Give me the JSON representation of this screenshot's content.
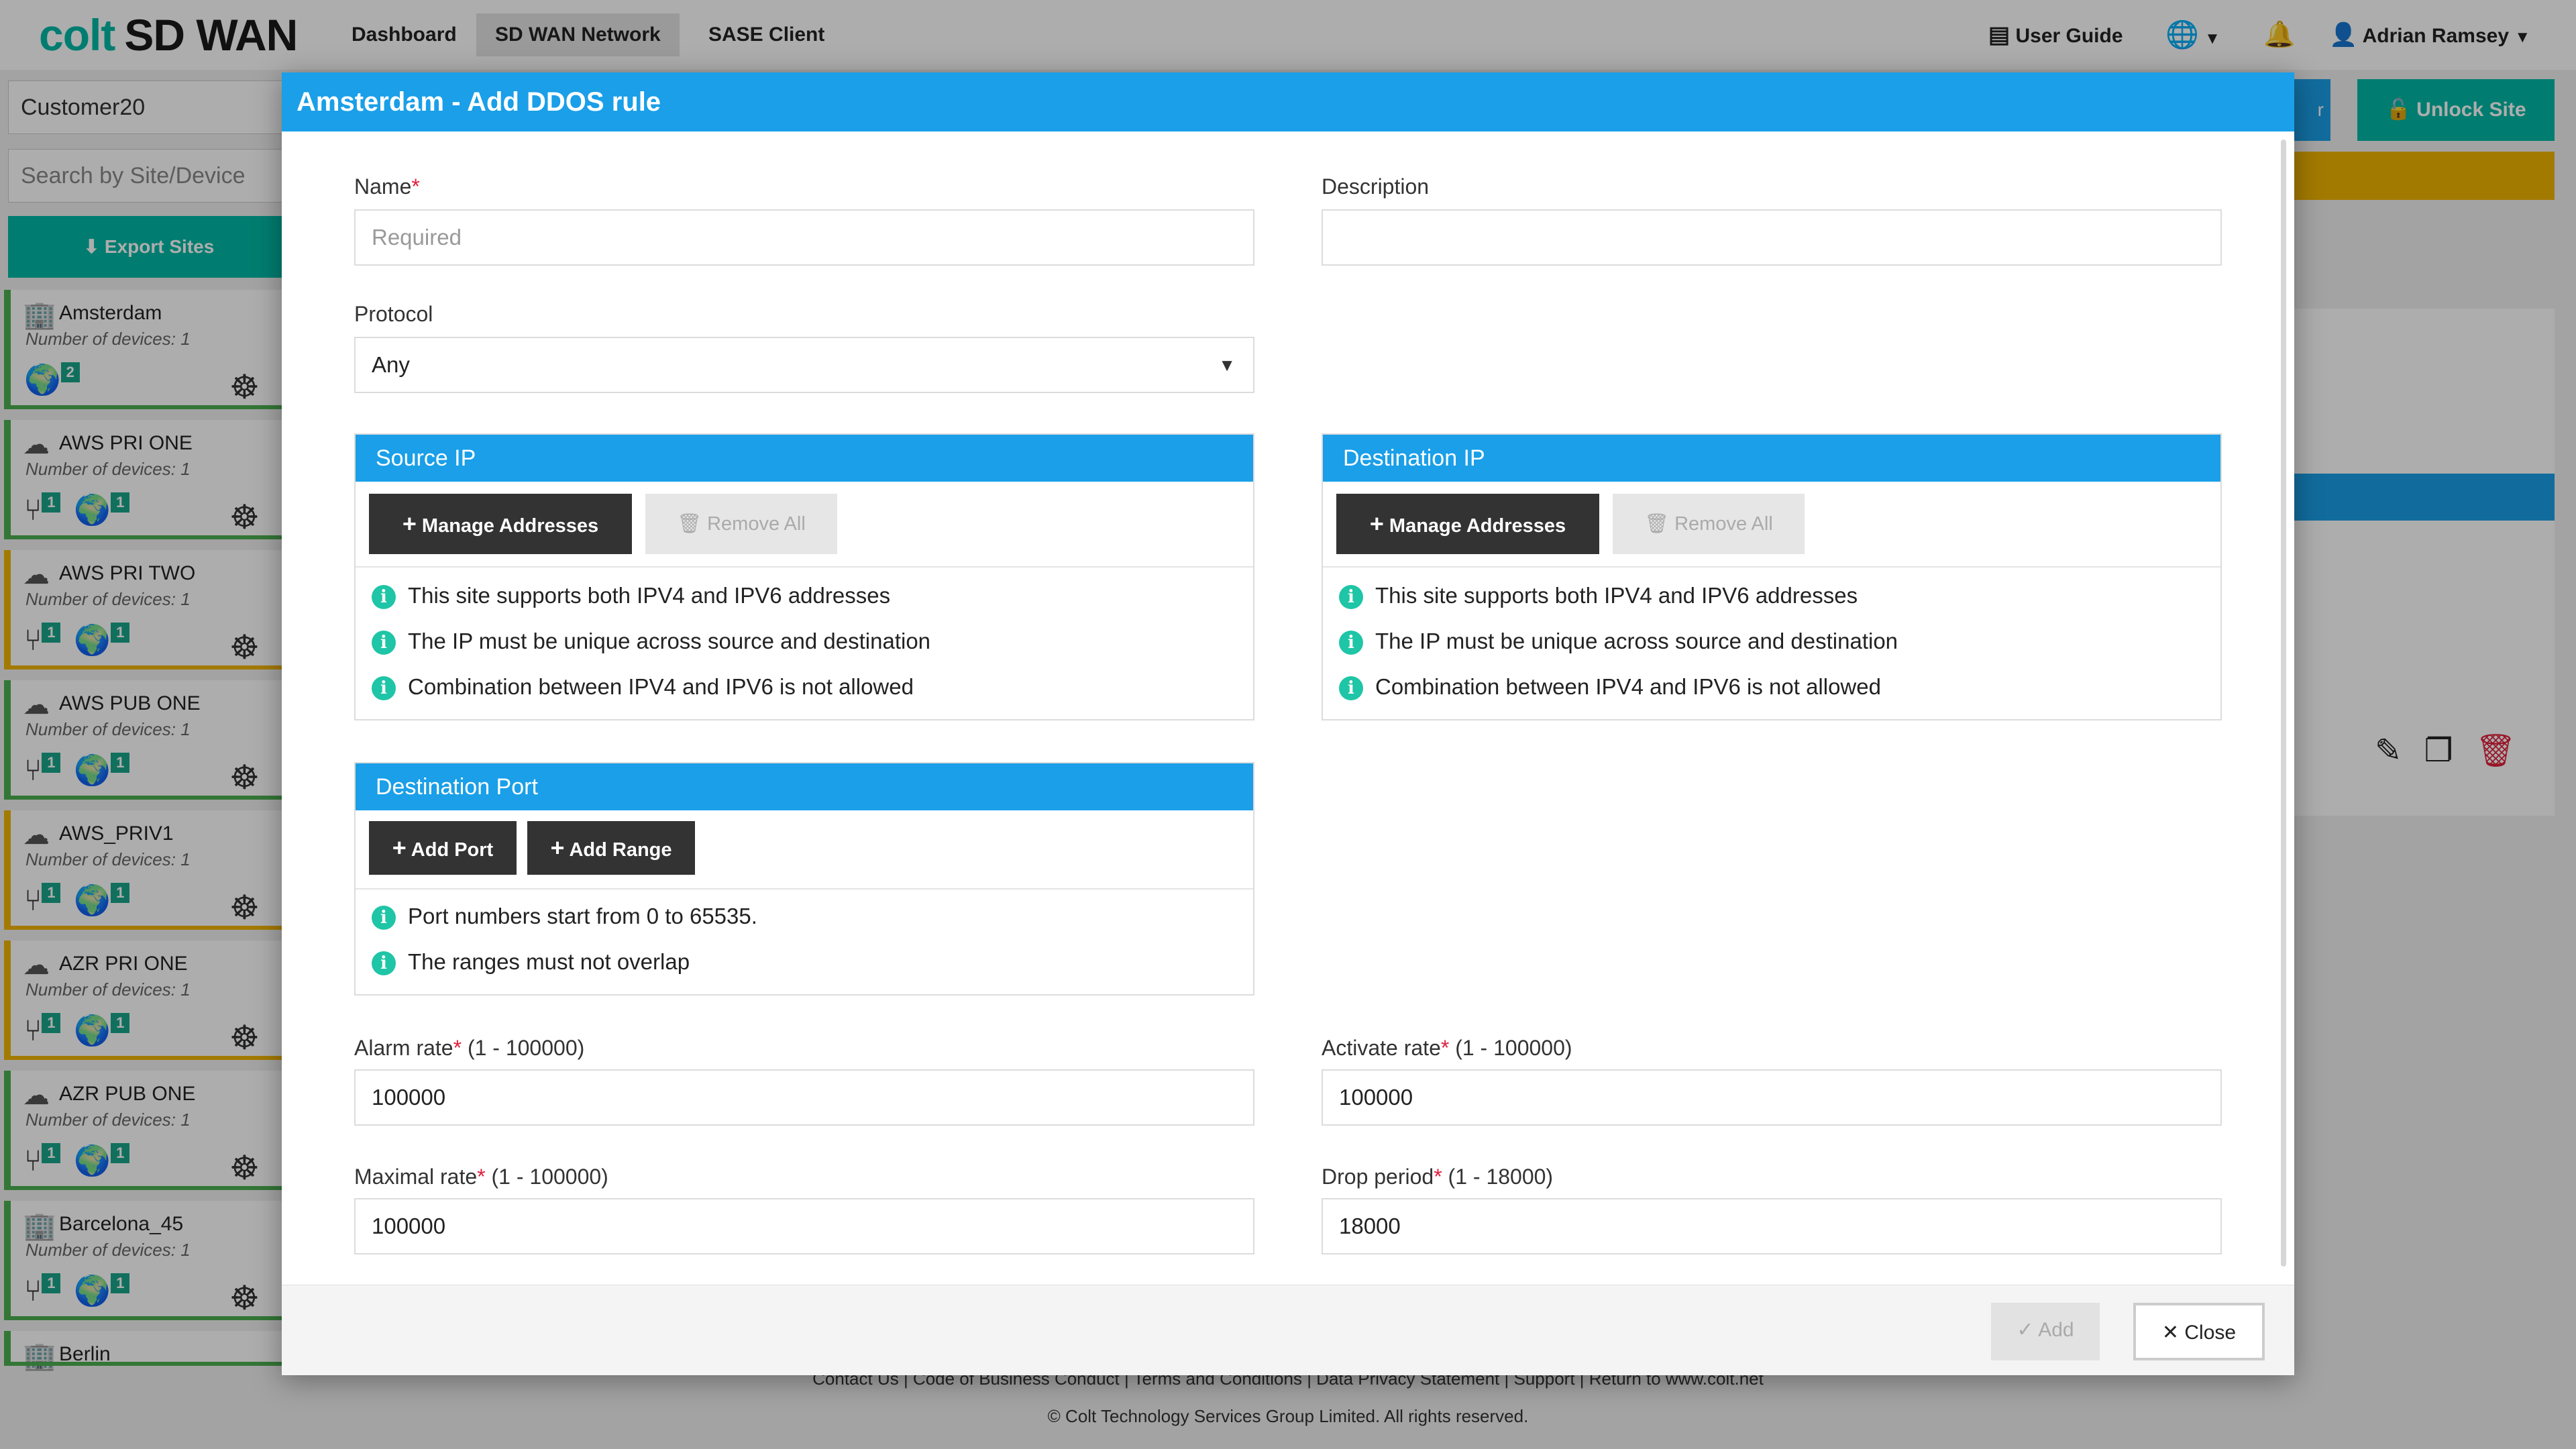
{
  "nav": {
    "brand_colt": "colt",
    "brand_sdwan": "SD WAN",
    "tabs": [
      "Dashboard",
      "SD WAN Network",
      "SASE Client"
    ],
    "active_tab": "SD WAN Network",
    "user_guide": "User Guide",
    "user_name": "Adrian Ramsey"
  },
  "sidebar": {
    "customer_value": "Customer20",
    "search_placeholder": "Search by Site/Device",
    "export_label": "Export Sites",
    "sites": [
      {
        "name": "Amsterdam",
        "devices": "Number of devices: 1",
        "badge1": "2",
        "badge2": "",
        "status": "green"
      },
      {
        "name": "AWS PRI ONE",
        "devices": "Number of devices: 1",
        "badge1": "1",
        "badge2": "1",
        "status": "green"
      },
      {
        "name": "AWS PRI TWO",
        "devices": "Number of devices: 1",
        "badge1": "1",
        "badge2": "1",
        "status": "amber"
      },
      {
        "name": "AWS PUB ONE",
        "devices": "Number of devices: 1",
        "badge1": "1",
        "badge2": "1",
        "status": "green"
      },
      {
        "name": "AWS_PRIV1",
        "devices": "Number of devices: 1",
        "badge1": "1",
        "badge2": "1",
        "status": "amber"
      },
      {
        "name": "AZR PRI ONE",
        "devices": "Number of devices: 1",
        "badge1": "1",
        "badge2": "1",
        "status": "amber"
      },
      {
        "name": "AZR PUB ONE",
        "devices": "Number of devices: 1",
        "badge1": "1",
        "badge2": "1",
        "status": "green"
      },
      {
        "name": "Barcelona_45",
        "devices": "Number of devices: 1",
        "badge1": "1",
        "badge2": "1",
        "status": "green"
      },
      {
        "name": "Berlin",
        "devices": "",
        "badge1": "",
        "badge2": "",
        "status": "green"
      }
    ]
  },
  "background": {
    "unlock_label": "Unlock Site",
    "blue_btn_fragment": "r"
  },
  "footer": {
    "links": "Contact Us |  Code of Business Conduct |  Terms and Conditions |  Data Privacy Statement |  Support |  Return to www.colt.net",
    "copyright": "© Colt Technology Services Group Limited. All rights reserved."
  },
  "modal": {
    "title": "Amsterdam - Add DDOS rule",
    "name_label": "Name",
    "name_placeholder": "Required",
    "description_label": "Description",
    "description_value": "",
    "protocol_label": "Protocol",
    "protocol_value": "Any",
    "source_ip": {
      "title": "Source IP",
      "manage_label": "Manage Addresses",
      "remove_label": "Remove All",
      "info": [
        "This site supports both IPV4 and IPV6 addresses",
        "The IP must be unique across source and destination",
        "Combination between IPV4 and IPV6 is not allowed"
      ]
    },
    "destination_ip": {
      "title": "Destination IP",
      "manage_label": "Manage Addresses",
      "remove_label": "Remove All",
      "info": [
        "This site supports both IPV4 and IPV6 addresses",
        "The IP must be unique across source and destination",
        "Combination between IPV4 and IPV6 is not allowed"
      ]
    },
    "destination_port": {
      "title": "Destination Port",
      "add_port_label": "Add Port",
      "add_range_label": "Add Range",
      "info": [
        "Port numbers start from 0 to 65535.",
        "The ranges must not overlap"
      ]
    },
    "alarm_rate_label": "Alarm rate",
    "alarm_rate_range": "(1 - 100000)",
    "alarm_rate_value": "100000",
    "activate_rate_label": "Activate rate",
    "activate_rate_range": "(1 - 100000)",
    "activate_rate_value": "100000",
    "maximal_rate_label": "Maximal rate",
    "maximal_rate_range": "(1 - 100000)",
    "maximal_rate_value": "100000",
    "drop_period_label": "Drop period",
    "drop_period_range": "(1 - 18000)",
    "drop_period_value": "18000",
    "add_label": "Add",
    "close_label": "Close"
  },
  "colors": {
    "primary_blue": "#1a9fe8",
    "brand_teal": "#00b8a6",
    "status_green": "#4caf50",
    "status_amber": "#f0b400",
    "required_red": "#e0203c"
  }
}
